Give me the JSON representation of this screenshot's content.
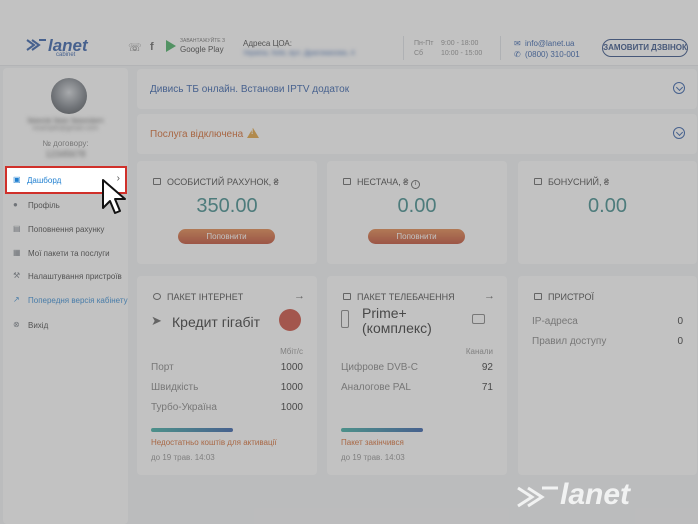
{
  "header": {
    "logo_text": "lanet",
    "logo_sub": "cabinet",
    "social": [
      "viber-icon",
      "facebook-icon"
    ],
    "gplay_small": "ЗАВАНТАЖУЙТЕ З",
    "gplay_big": "Google Play",
    "address_label": "Адреса ЦОА:",
    "address_value": "Україна, Київ, вул. Драгоманова, 4",
    "hours_days_1": "Пн-Пт",
    "hours_time_1": "9:00 - 18:00",
    "hours_days_2": "Сб",
    "hours_time_2": "10:00 - 15:00",
    "email": "info@lanet.ua",
    "phone": "(0800) 310-001",
    "callback": "ЗАМОВИТИ ДЗВІНОК"
  },
  "user": {
    "name": "Іванов Іван Іванович",
    "email": "example@gmail.com",
    "contract_label": "№ договору:",
    "contract_value": "12345678"
  },
  "nav": [
    {
      "label": "Дашборд",
      "icon": "dashboard-icon"
    },
    {
      "label": "Профіль",
      "icon": "user-icon"
    },
    {
      "label": "Поповнення рахунку",
      "icon": "wallet-icon"
    },
    {
      "label": "Мої пакети та послуги",
      "icon": "package-icon"
    },
    {
      "label": "Налаштування пристроїв",
      "icon": "wrench-icon"
    },
    {
      "label": "Попередня версія кабінету",
      "icon": "external-link-icon"
    },
    {
      "label": "Вихід",
      "icon": "logout-icon"
    }
  ],
  "banners": {
    "iptv": "Дивись ТБ онлайн. Встанови IPTV додаток",
    "disabled": "Послуга відключена"
  },
  "cards": {
    "personal": {
      "title": "ОСОБИСТИЙ РАХУНОК, ₴",
      "amount": "350.00",
      "button": "Поповнити"
    },
    "shortage": {
      "title": "НЕСТАЧА, ₴",
      "amount": "0.00",
      "button": "Поповнити",
      "info": "i"
    },
    "bonus": {
      "title": "БОНУСНИЙ, ₴",
      "amount": "0.00"
    }
  },
  "internet": {
    "title": "ПАКЕТ ІНТЕРНЕТ",
    "name": "Кредит гігабіт",
    "unit": "Мбіт/с",
    "rows": [
      {
        "k": "Порт",
        "v": "1000"
      },
      {
        "k": "Швидкість",
        "v": "1000"
      },
      {
        "k": "Турбо-Україна",
        "v": "1000"
      }
    ],
    "status": "Недостатньо коштів для активації",
    "date": "до 19 трав. 14:03"
  },
  "tv": {
    "title": "ПАКЕТ ТЕЛЕБАЧЕННЯ",
    "name_line1": "Prime+",
    "name_line2": "(комплекс)",
    "unit": "Канали",
    "rows": [
      {
        "k": "Цифрове DVB-C",
        "v": "92"
      },
      {
        "k": "Аналогове PAL",
        "v": "71"
      }
    ],
    "status": "Пакет закінчився",
    "date": "до 19 трав. 14:03"
  },
  "devices": {
    "title": "ПРИСТРОЇ",
    "rows": [
      {
        "k": "IP-адреса",
        "v": "0"
      },
      {
        "k": "Правил доступу",
        "v": "0"
      }
    ]
  },
  "watermark": "lanet"
}
